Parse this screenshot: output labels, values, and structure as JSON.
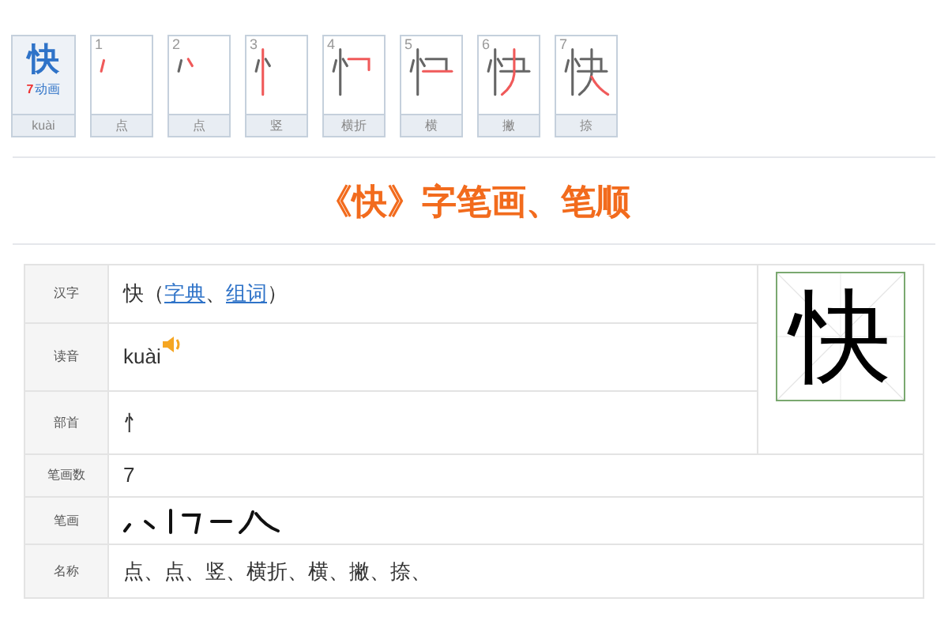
{
  "summary_box": {
    "character": "快",
    "count": "7",
    "animation_link": "动画",
    "pinyin": "kuài"
  },
  "stroke_frames": [
    {
      "number": "1",
      "name": "点"
    },
    {
      "number": "2",
      "name": "点"
    },
    {
      "number": "3",
      "name": "竖"
    },
    {
      "number": "4",
      "name": "横折"
    },
    {
      "number": "5",
      "name": "横"
    },
    {
      "number": "6",
      "name": "撇"
    },
    {
      "number": "7",
      "name": "捺"
    }
  ],
  "heading": "《快》字笔画、笔顺",
  "info_table": {
    "character_display": "快",
    "rows": [
      {
        "kind": "parts",
        "label": "汉字",
        "parts": [
          {
            "text": "快（",
            "link": false
          },
          {
            "text": "字典",
            "link": true
          },
          {
            "text": "、",
            "link": false
          },
          {
            "text": "组词",
            "link": true
          },
          {
            "text": "）",
            "link": false
          }
        ]
      },
      {
        "kind": "pinyin",
        "label": "读音",
        "value": "kuài"
      },
      {
        "kind": "text",
        "label": "部首",
        "value": "忄"
      },
      {
        "kind": "text",
        "label": "笔画数",
        "value": "7"
      },
      {
        "kind": "strokes",
        "label": "笔画"
      },
      {
        "kind": "text",
        "label": "名称",
        "value": "点、点、竖、横折、横、撇、捺、"
      }
    ]
  }
}
